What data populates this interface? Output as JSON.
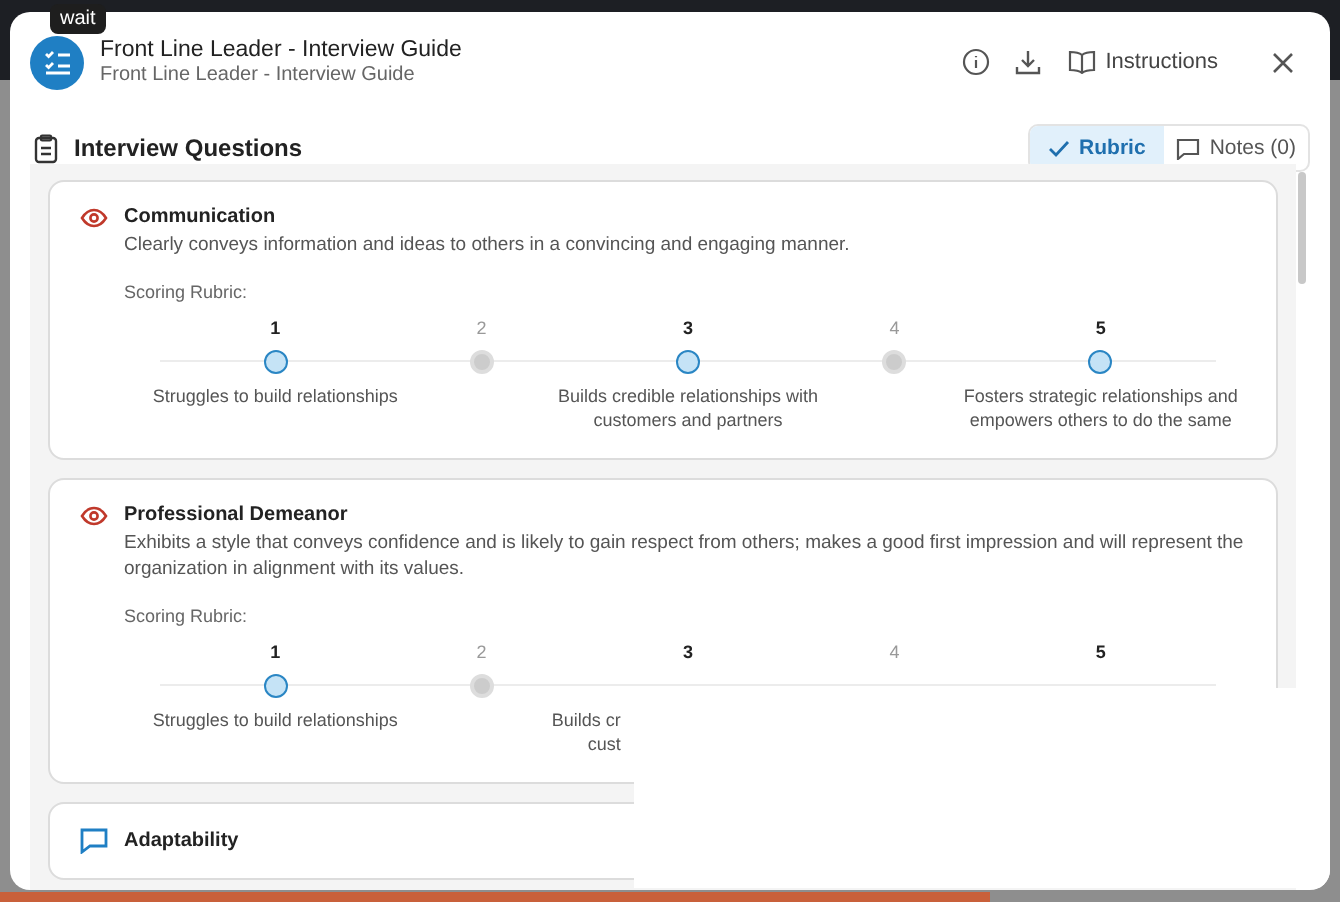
{
  "tooltip": "wait",
  "header": {
    "title": "Front Line Leader - Interview Guide",
    "subtitle": "Front Line Leader - Interview Guide",
    "instructions_label": "Instructions"
  },
  "section_title": "Interview Questions",
  "view_tabs": [
    {
      "label": "Rubric",
      "kind": "check",
      "selected": true
    },
    {
      "label": "Notes (0)",
      "kind": "comment",
      "selected": false
    }
  ],
  "questions": [
    {
      "title": "Communication",
      "kind": "eye",
      "description": "Clearly conveys information and ideas to others in a convincing and engaging manner.",
      "rubric_label": "Scoring Rubric:",
      "points": [
        {
          "number": "1",
          "highlighted": true,
          "dot_visible": true,
          "description_lines": [
            "Struggles to build relationships"
          ]
        },
        {
          "number": "2",
          "highlighted": false,
          "dot_visible": true
        },
        {
          "number": "3",
          "highlighted": true,
          "dot_visible": true,
          "description_lines": [
            "Builds credible relationships with",
            "customers and partners"
          ]
        },
        {
          "number": "4",
          "highlighted": false,
          "dot_visible": true
        },
        {
          "number": "5",
          "highlighted": true,
          "dot_visible": true,
          "description_lines": [
            "Fosters strategic relationships and",
            "empowers others to do the same"
          ]
        }
      ]
    },
    {
      "title": "Professional Demeanor",
      "kind": "eye",
      "description": "Exhibits a style that conveys confidence and is likely to gain respect from others; makes a good first impression and will represent the organization in alignment with its values.",
      "rubric_label": "Scoring Rubric:",
      "points": [
        {
          "number": "1",
          "highlighted": true,
          "dot_visible": true,
          "description_lines": [
            "Struggles to build relationships"
          ]
        },
        {
          "number": "2",
          "highlighted": false,
          "dot_visible": true
        },
        {
          "number": "3",
          "highlighted": true,
          "dot_visible": false,
          "cut": true,
          "description_lines": [
            "Builds cr",
            "cust"
          ]
        },
        {
          "number": "4",
          "highlighted": false,
          "dot_visible": false
        },
        {
          "number": "5",
          "highlighted": true,
          "dot_visible": false
        }
      ]
    },
    {
      "title": "Adaptability",
      "kind": "chat"
    }
  ]
}
